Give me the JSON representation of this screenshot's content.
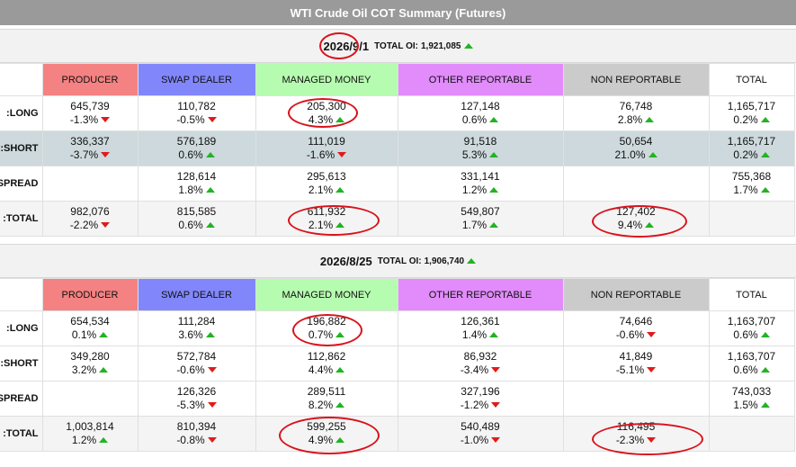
{
  "title": "WTI Crude Oil COT Summary (Futures)",
  "total_oi_label": "TOTAL OI:",
  "columns": [
    "PRODUCER",
    "SWAP DEALER",
    "MANAGED MONEY",
    "OTHER REPORTABLE",
    "NON REPORTABLE",
    "TOTAL"
  ],
  "colors": {
    "producer": "#f48282",
    "swap_dealer": "#8187fb",
    "managed_money": "#b6fcb0",
    "other_reportable": "#e18cfa",
    "non_reportable": "#cbcbcb",
    "up_arrow": "#22b322",
    "down_arrow": "#e01b1b",
    "annotation_circle": "#d9121b"
  },
  "icons": {
    "up": "green-up-triangle-icon",
    "down": "red-down-triangle-icon"
  },
  "blocks": [
    {
      "date": "2026/9/1",
      "total_oi": "1,921,085",
      "total_oi_dir": "up",
      "rows": [
        {
          "label": "LONG:",
          "cells": [
            {
              "value": "645,739",
              "pct": "-1.3%",
              "dir": "down"
            },
            {
              "value": "110,782",
              "pct": "-0.5%",
              "dir": "down"
            },
            {
              "value": "205,300",
              "pct": "4.3%",
              "dir": "up"
            },
            {
              "value": "127,148",
              "pct": "0.6%",
              "dir": "up"
            },
            {
              "value": "76,748",
              "pct": "2.8%",
              "dir": "up"
            },
            {
              "value": "1,165,717",
              "pct": "0.2%",
              "dir": "up"
            }
          ]
        },
        {
          "label": "SHORT:",
          "cells": [
            {
              "value": "336,337",
              "pct": "-3.7%",
              "dir": "down"
            },
            {
              "value": "576,189",
              "pct": "0.6%",
              "dir": "up"
            },
            {
              "value": "111,019",
              "pct": "-1.6%",
              "dir": "down"
            },
            {
              "value": "91,518",
              "pct": "5.3%",
              "dir": "up"
            },
            {
              "value": "50,654",
              "pct": "21.0%",
              "dir": "up"
            },
            {
              "value": "1,165,717",
              "pct": "0.2%",
              "dir": "up"
            }
          ]
        },
        {
          "label": "SPREAD:",
          "cells": [
            {
              "value": "",
              "pct": "",
              "dir": ""
            },
            {
              "value": "128,614",
              "pct": "1.8%",
              "dir": "up"
            },
            {
              "value": "295,613",
              "pct": "2.1%",
              "dir": "up"
            },
            {
              "value": "331,141",
              "pct": "1.2%",
              "dir": "up"
            },
            {
              "value": "",
              "pct": "",
              "dir": ""
            },
            {
              "value": "755,368",
              "pct": "1.7%",
              "dir": "up"
            }
          ]
        },
        {
          "label": "TOTAL:",
          "cells": [
            {
              "value": "982,076",
              "pct": "-2.2%",
              "dir": "down"
            },
            {
              "value": "815,585",
              "pct": "0.6%",
              "dir": "up"
            },
            {
              "value": "611,932",
              "pct": "2.1%",
              "dir": "up"
            },
            {
              "value": "549,807",
              "pct": "1.7%",
              "dir": "up"
            },
            {
              "value": "127,402",
              "pct": "9.4%",
              "dir": "up"
            },
            {
              "value": "",
              "pct": "",
              "dir": ""
            }
          ]
        }
      ]
    },
    {
      "date": "2026/8/25",
      "total_oi": "1,906,740",
      "total_oi_dir": "up",
      "rows": [
        {
          "label": "LONG:",
          "cells": [
            {
              "value": "654,534",
              "pct": "0.1%",
              "dir": "up"
            },
            {
              "value": "111,284",
              "pct": "3.6%",
              "dir": "up"
            },
            {
              "value": "196,882",
              "pct": "0.7%",
              "dir": "up"
            },
            {
              "value": "126,361",
              "pct": "1.4%",
              "dir": "up"
            },
            {
              "value": "74,646",
              "pct": "-0.6%",
              "dir": "down"
            },
            {
              "value": "1,163,707",
              "pct": "0.6%",
              "dir": "up"
            }
          ]
        },
        {
          "label": "SHORT:",
          "cells": [
            {
              "value": "349,280",
              "pct": "3.2%",
              "dir": "up"
            },
            {
              "value": "572,784",
              "pct": "-0.6%",
              "dir": "down"
            },
            {
              "value": "112,862",
              "pct": "4.4%",
              "dir": "up"
            },
            {
              "value": "86,932",
              "pct": "-3.4%",
              "dir": "down"
            },
            {
              "value": "41,849",
              "pct": "-5.1%",
              "dir": "down"
            },
            {
              "value": "1,163,707",
              "pct": "0.6%",
              "dir": "up"
            }
          ]
        },
        {
          "label": "SPREAD:",
          "cells": [
            {
              "value": "",
              "pct": "",
              "dir": ""
            },
            {
              "value": "126,326",
              "pct": "-5.3%",
              "dir": "down"
            },
            {
              "value": "289,511",
              "pct": "8.2%",
              "dir": "up"
            },
            {
              "value": "327,196",
              "pct": "-1.2%",
              "dir": "down"
            },
            {
              "value": "",
              "pct": "",
              "dir": ""
            },
            {
              "value": "743,033",
              "pct": "1.5%",
              "dir": "up"
            }
          ]
        },
        {
          "label": "TOTAL:",
          "cells": [
            {
              "value": "1,003,814",
              "pct": "1.2%",
              "dir": "up"
            },
            {
              "value": "810,394",
              "pct": "-0.8%",
              "dir": "down"
            },
            {
              "value": "599,255",
              "pct": "4.9%",
              "dir": "up"
            },
            {
              "value": "540,489",
              "pct": "-1.0%",
              "dir": "down"
            },
            {
              "value": "116,495",
              "pct": "-2.3%",
              "dir": "down"
            },
            {
              "value": "",
              "pct": "",
              "dir": ""
            }
          ]
        }
      ]
    }
  ]
}
